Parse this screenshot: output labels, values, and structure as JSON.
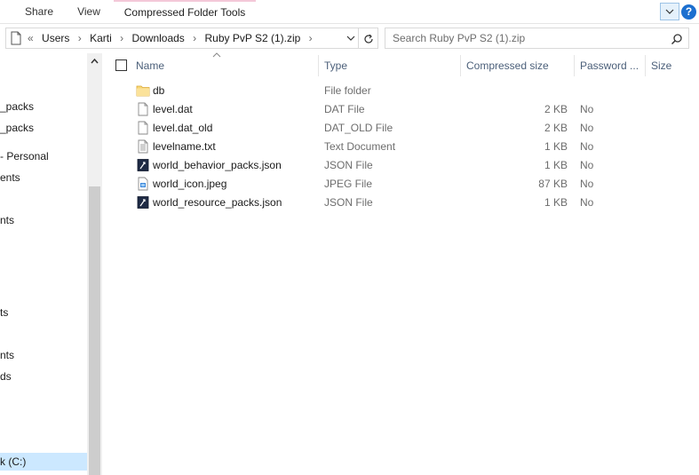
{
  "ribbon": {
    "tabs": [
      {
        "label": "Share"
      },
      {
        "label": "View"
      },
      {
        "label": "Compressed Folder Tools"
      }
    ],
    "help": "?"
  },
  "address": {
    "overflow": "«",
    "crumbs": [
      "Users",
      "Karti",
      "Downloads",
      "Ruby PvP S2 (1).zip"
    ]
  },
  "search": {
    "placeholder": "Search Ruby PvP S2 (1).zip"
  },
  "nav": {
    "items": [
      {
        "label": "_packs"
      },
      {
        "label": "_packs"
      },
      {
        "label": "- Personal"
      },
      {
        "label": "ents"
      },
      {
        "label": "nts"
      },
      {
        "label": "ts"
      },
      {
        "label": "nts"
      },
      {
        "label": "ds"
      },
      {
        "label": "k (C:)"
      }
    ]
  },
  "columns": {
    "name": "Name",
    "type": "Type",
    "compressed_size": "Compressed size",
    "password": "Password ...",
    "size": "Size"
  },
  "files": [
    {
      "name": "db",
      "type": "File folder",
      "compressed_size": "",
      "password": "",
      "icon": "folder-icon"
    },
    {
      "name": "level.dat",
      "type": "DAT File",
      "compressed_size": "2 KB",
      "password": "No",
      "icon": "file-icon"
    },
    {
      "name": "level.dat_old",
      "type": "DAT_OLD File",
      "compressed_size": "2 KB",
      "password": "No",
      "icon": "file-icon"
    },
    {
      "name": "levelname.txt",
      "type": "Text Document",
      "compressed_size": "1 KB",
      "password": "No",
      "icon": "text-file-icon"
    },
    {
      "name": "world_behavior_packs.json",
      "type": "JSON File",
      "compressed_size": "1 KB",
      "password": "No",
      "icon": "json-file-icon"
    },
    {
      "name": "world_icon.jpeg",
      "type": "JPEG File",
      "compressed_size": "87 KB",
      "password": "No",
      "icon": "image-file-icon"
    },
    {
      "name": "world_resource_packs.json",
      "type": "JSON File",
      "compressed_size": "1 KB",
      "password": "No",
      "icon": "json-file-icon"
    }
  ],
  "colors": {
    "accent": "#1c6fcf",
    "contextual_tab": "#f4c8d8",
    "nav_selected": "#cce8ff"
  }
}
